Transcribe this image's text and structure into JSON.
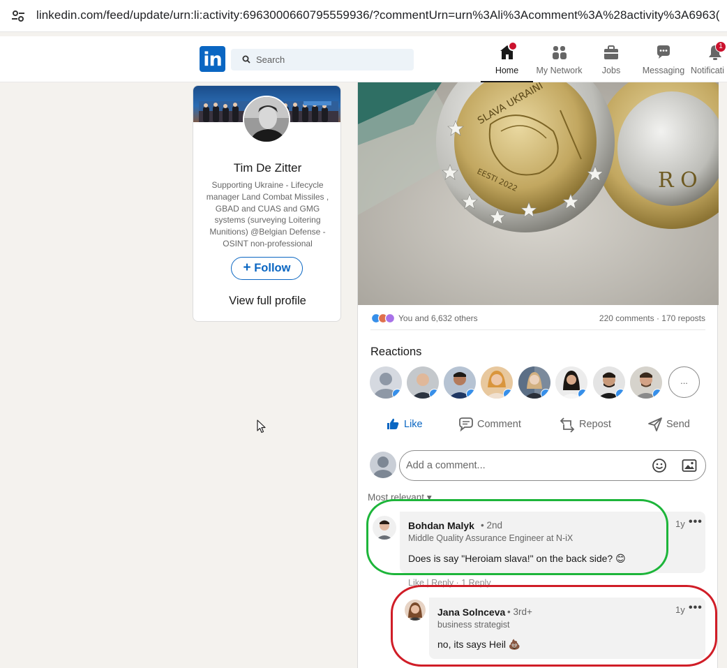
{
  "browser": {
    "url": "linkedin.com/feed/update/urn:li:activity:6963000660795559936/?commentUrn=urn%3Ali%3Acomment%3A%28activity%3A6963("
  },
  "nav": {
    "logo": "in",
    "search_placeholder": "Search",
    "items": [
      {
        "label": "Home",
        "icon": "home-icon"
      },
      {
        "label": "My Network",
        "icon": "network-icon"
      },
      {
        "label": "Jobs",
        "icon": "briefcase-icon"
      },
      {
        "label": "Messaging",
        "icon": "messaging-icon"
      },
      {
        "label": "Notificati",
        "icon": "bell-icon",
        "badge": "1"
      }
    ]
  },
  "profile": {
    "name": "Tim De Zitter",
    "headline": "Supporting Ukraine - Lifecycle manager Land Combat Missiles , GBAD and CUAS and GMG systems (surveying Loitering Munitions) @Belgian Defense - OSINT non-professional",
    "follow_label": "Follow",
    "view_profile_label": "View full profile"
  },
  "post": {
    "image_alt": "Estonian 2 euro coin 'SLAVA UKRAINI' EESTI 2022",
    "coin_text_top": "SLAVA UKRAINI",
    "coin_text_bottom": "EESTI 2022",
    "reactions_summary": "You and 6,632 others",
    "comments_reposts": "220 comments · 170 reposts",
    "reactions_title": "Reactions",
    "more_reactors": "...",
    "actions": {
      "like": "Like",
      "comment": "Comment",
      "repost": "Repost",
      "send": "Send"
    },
    "comment_placeholder": "Add a comment...",
    "sort_label": "Most relevant"
  },
  "comments": [
    {
      "name": "Bohdan Malyk",
      "degree": "• 2nd",
      "headline": "Middle Quality Assurance Engineer at N-iX",
      "text": "Does is say \"Heroiam slava!\" on the back side? 😊",
      "time": "1y",
      "more": "•••",
      "actions": "Like  |  Reply  ·  1 Reply"
    },
    {
      "name": "Jana Solnceva",
      "degree": "• 3rd+",
      "headline": "business strategist",
      "text": "no, its says Heil 💩",
      "time": "1y",
      "more": "•••"
    }
  ],
  "colors": {
    "linkedin_blue": "#0a66c2",
    "highlight_green": "#1db53a",
    "highlight_red": "#d01d27",
    "notification_red": "#cb112d"
  }
}
